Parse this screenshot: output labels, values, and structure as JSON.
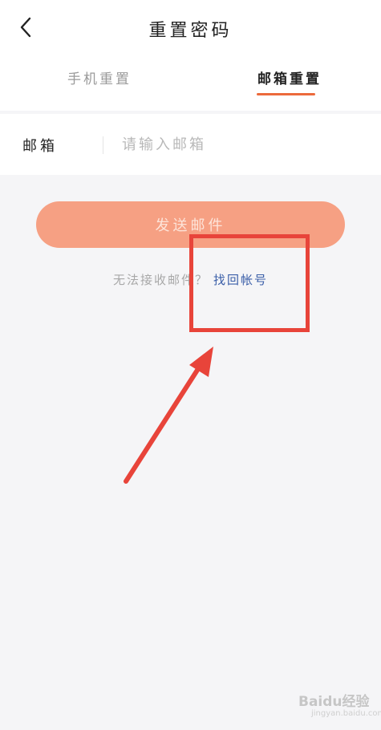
{
  "header": {
    "title": "重置密码",
    "back_icon": "chevron-left-icon"
  },
  "tabs": [
    {
      "label": "手机重置",
      "active": false
    },
    {
      "label": "邮箱重置",
      "active": true
    }
  ],
  "form": {
    "email_label": "邮箱",
    "email_value": "",
    "email_placeholder": "请输入邮箱"
  },
  "send_button": {
    "label": "发送邮件"
  },
  "help": {
    "text": "无法接收邮件？",
    "link": "找回帐号"
  },
  "watermark": {
    "text": "Baidu经验",
    "sub": "jingyan.baidu.com"
  },
  "colors": {
    "accent": "#ec6a3c",
    "button": "#f6a083",
    "link": "#3a5ea8",
    "annotation": "#e8443a"
  }
}
